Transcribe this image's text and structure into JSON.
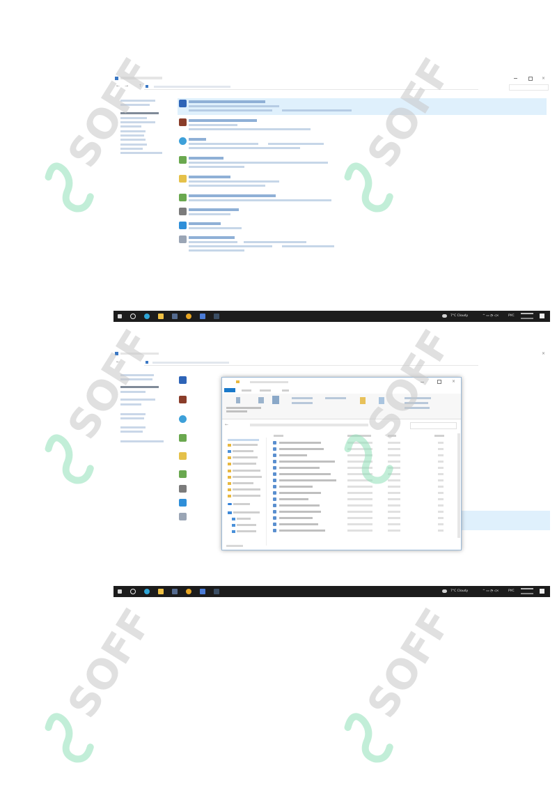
{
  "taskbar": {
    "weather": "7°C Cloudy",
    "language": "РУС"
  },
  "watermark": {
    "text": "SOFF"
  },
  "colors": {
    "accent": "#1979ca",
    "taskbar": "#1c1c1c",
    "watermark_green": "#6fd3a3",
    "watermark_grey": "#b8b8b8",
    "highlight": "#dff0fc"
  }
}
